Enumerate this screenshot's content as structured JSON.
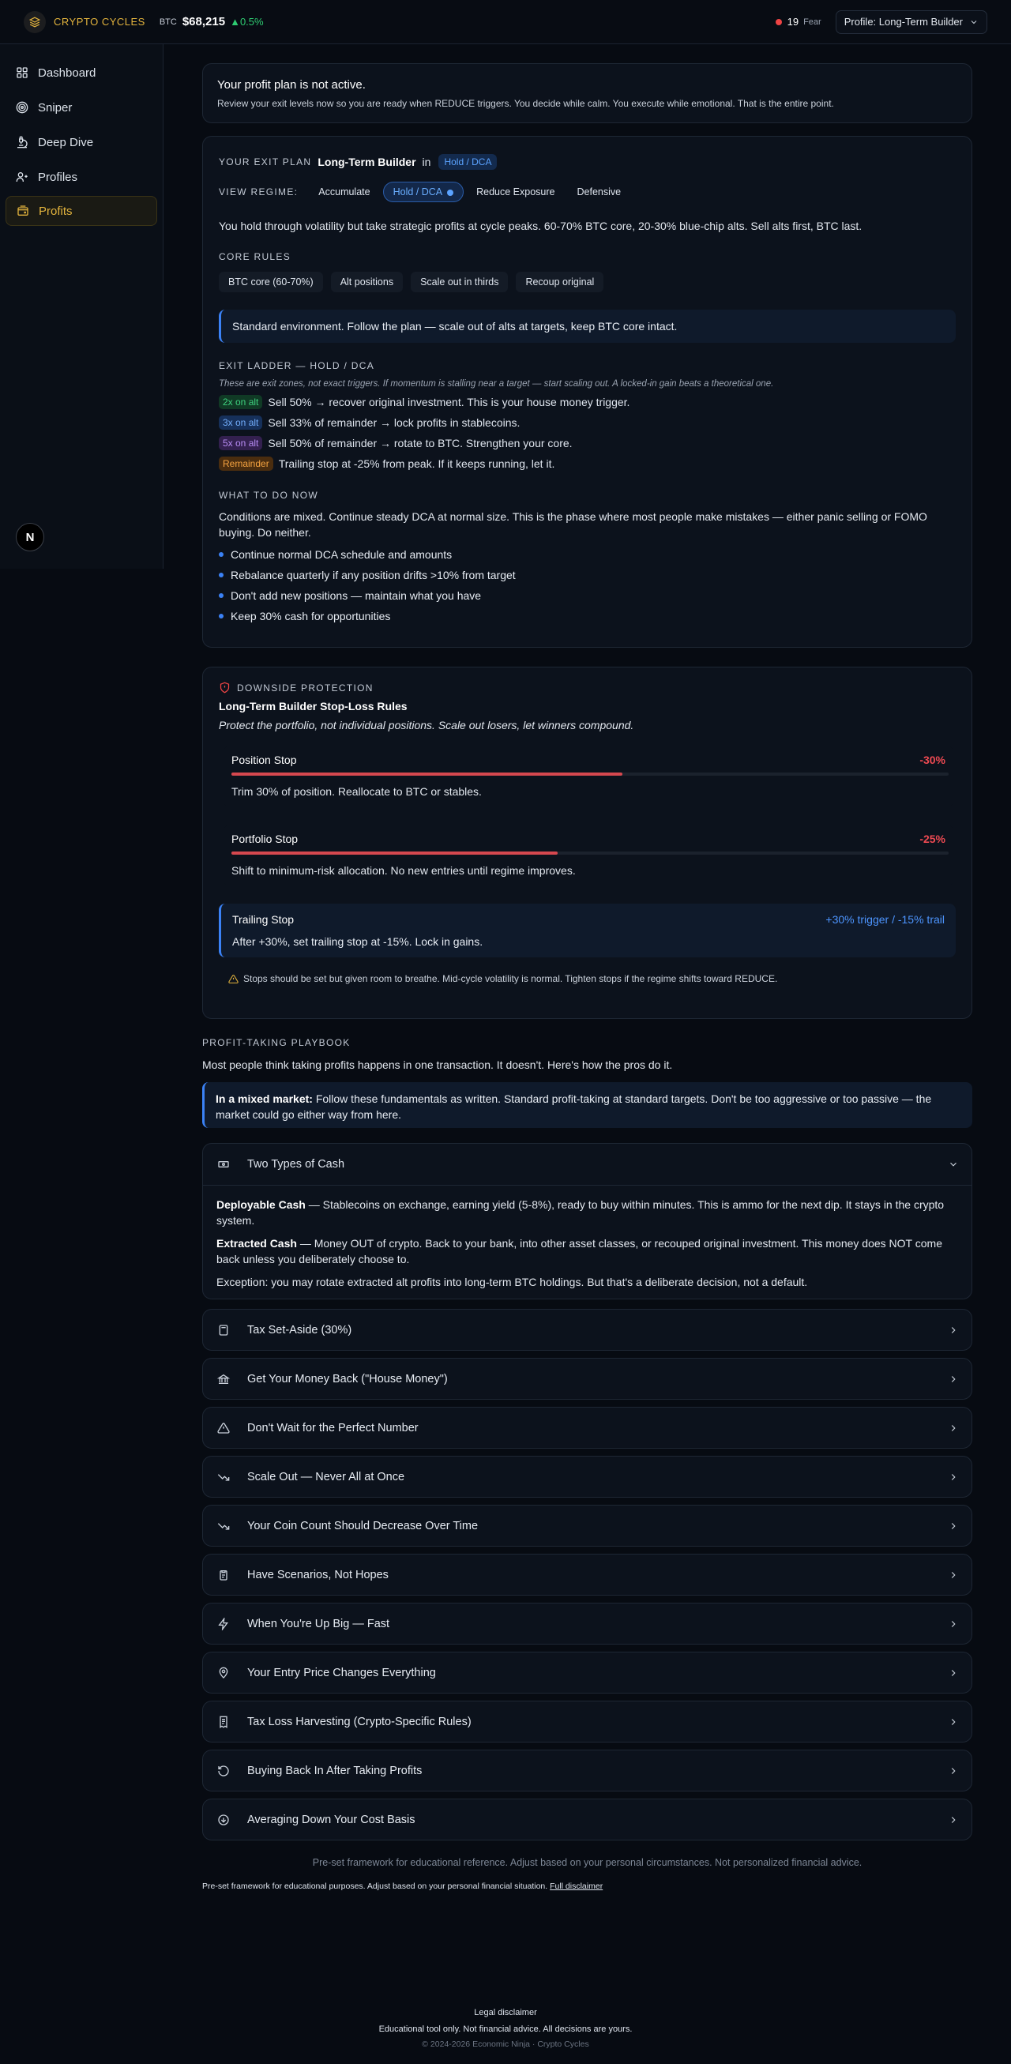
{
  "topbar": {
    "brand": "CRYPTO CYCLES",
    "btc_label": "BTC",
    "btc_price": "$68,215",
    "btc_change": "▲0.5%",
    "fear_value": "19",
    "fear_label": "Fear",
    "profile_label": "Profile: Long-Term Builder"
  },
  "sidebar": {
    "items": [
      {
        "label": "Dashboard",
        "icon": "grid-icon"
      },
      {
        "label": "Sniper",
        "icon": "target-icon"
      },
      {
        "label": "Deep Dive",
        "icon": "microscope-icon"
      },
      {
        "label": "Profiles",
        "icon": "users-icon"
      },
      {
        "label": "Profits",
        "icon": "wallet-icon"
      }
    ],
    "badge": "N"
  },
  "inactive": {
    "title": "Your profit plan is not active.",
    "text": "Review your exit levels now so you are ready when REDUCE triggers. You decide while calm. You execute while emotional. That is the entire point."
  },
  "plan": {
    "caption": "YOUR EXIT PLAN",
    "profile": "Long-Term Builder",
    "in": "in",
    "regime_pill": "Hold / DCA",
    "view_caption": "VIEW REGIME:",
    "regimes": [
      "Accumulate",
      "Hold / DCA",
      "Reduce Exposure",
      "Defensive"
    ],
    "description": "You hold through volatility but take strategic profits at cycle peaks. 60-70% BTC core, 20-30% blue-chip alts. Sell alts first, BTC last.",
    "core_caption": "CORE RULES",
    "core_rules": [
      "BTC core (60-70%)",
      "Alt positions",
      "Scale out in thirds",
      "Recoup original"
    ],
    "callout": "Standard environment. Follow the plan — scale out of alts at targets, keep BTC core intact.",
    "ladder_caption": "EXIT LADDER — HOLD / DCA",
    "ladder_note": "These are exit zones, not exact triggers. If momentum is stalling near a target — start scaling out. A locked-in gain beats a theoretical one.",
    "ladder": [
      {
        "tag": "2x on alt",
        "text": "Sell 50% → recover original investment. This is your house money trigger."
      },
      {
        "tag": "3x on alt",
        "text": "Sell 33% of remainder → lock profits in stablecoins."
      },
      {
        "tag": "5x on alt",
        "text": "Sell 50% of remainder → rotate to BTC. Strengthen your core."
      },
      {
        "tag": "Remainder",
        "text": "Trailing stop at -25% from peak. If it keeps running, let it."
      }
    ],
    "now_caption": "WHAT TO DO NOW",
    "now_text": "Conditions are mixed. Continue steady DCA at normal size. This is the phase where most people make mistakes — either panic selling or FOMO buying. Do neither.",
    "bullets": [
      "Continue normal DCA schedule and amounts",
      "Rebalance quarterly if any position drifts >10% from target",
      "Don't add new positions — maintain what you have",
      "Keep 30% cash for opportunities"
    ]
  },
  "downside": {
    "caption": "DOWNSIDE PROTECTION",
    "title": "Long-Term Builder Stop-Loss Rules",
    "subtitle": "Protect the portfolio, not individual positions. Scale out losers, let winners compound.",
    "stops": [
      {
        "name": "Position Stop",
        "value": "-30%",
        "level": 0.3,
        "text": "Trim 30% of position. Reallocate to BTC or stables."
      },
      {
        "name": "Portfolio Stop",
        "value": "-25%",
        "level": 0.25,
        "text": "Shift to minimum-risk allocation. No new entries until regime improves."
      }
    ],
    "trailing": {
      "name": "Trailing Stop",
      "value": "+30% trigger / -15% trail",
      "text": "After +30%, set trailing stop at -15%. Lock in gains."
    },
    "note": "Stops should be set but given room to breathe. Mid-cycle volatility is normal. Tighten stops if the regime shifts toward REDUCE."
  },
  "playbook": {
    "caption": "PROFIT-TAKING PLAYBOOK",
    "intro": "Most people think taking profits happens in one transaction. It doesn't. Here's how the pros do it.",
    "market_bold": "In a mixed market:",
    "market_text": "Follow these fundamentals as written. Standard profit-taking at standard targets. Don't be too aggressive or too passive — the market could go either way from here.",
    "open_title": "Two Types of Cash",
    "open_p1_bold": "Deployable Cash",
    "open_p1": "— Stablecoins on exchange, earning yield (5-8%), ready to buy within minutes. This is ammo for the next dip. It stays in the crypto system.",
    "open_p2_bold": "Extracted Cash",
    "open_p2": "— Money OUT of crypto. Back to your bank, into other asset classes, or recouped original investment. This money does NOT come back unless you deliberately choose to.",
    "open_p3": "Exception: you may rotate extracted alt profits into long-term BTC holdings. But that's a deliberate decision, not a default.",
    "items": [
      {
        "label": "Tax Set-Aside (30%)",
        "icon": "calculator-icon"
      },
      {
        "label": "Get Your Money Back (\"House Money\")",
        "icon": "bank-icon"
      },
      {
        "label": "Don't Wait for the Perfect Number",
        "icon": "warning-icon"
      },
      {
        "label": "Scale Out — Never All at Once",
        "icon": "trending-down-icon"
      },
      {
        "label": "Your Coin Count Should Decrease Over Time",
        "icon": "trending-down-icon"
      },
      {
        "label": "Have Scenarios, Not Hopes",
        "icon": "clipboard-icon"
      },
      {
        "label": "When You're Up Big — Fast",
        "icon": "zap-icon"
      },
      {
        "label": "Your Entry Price Changes Everything",
        "icon": "map-pin-icon"
      },
      {
        "label": "Tax Loss Harvesting (Crypto-Specific Rules)",
        "icon": "receipt-icon"
      },
      {
        "label": "Buying Back In After Taking Profits",
        "icon": "rotate-icon"
      },
      {
        "label": "Averaging Down Your Cost Basis",
        "icon": "arrow-down-circle-icon"
      }
    ],
    "disclaimer_center": "Pre-set framework for educational reference. Adjust based on your personal circumstances. Not personalized financial advice.",
    "disclaimer_left": "Pre-set framework for educational purposes. Adjust based on your personal financial situation.",
    "disclaimer_link": "Full disclaimer"
  },
  "footer": {
    "legal": "Legal disclaimer",
    "edu": "Educational tool only. Not financial advice. All decisions are yours.",
    "copyright": "© 2024-2026 Economic Ninja · Crypto Cycles"
  },
  "colors": {
    "accent_gold": "#e2b33d",
    "blue": "#3b82f6",
    "red": "#d6484f",
    "green": "#2ecb71"
  }
}
